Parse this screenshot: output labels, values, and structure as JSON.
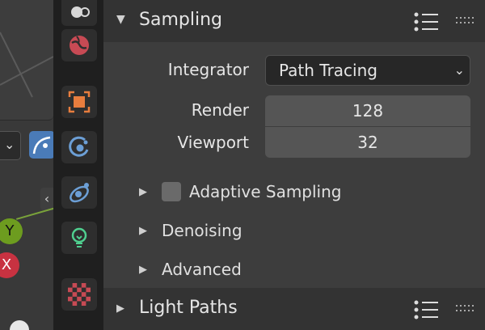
{
  "colors": {
    "panel_bg": "#3d3d3d",
    "header_bg": "#333333",
    "tab_column_bg": "#1f1f1f",
    "field_bg": "#555555",
    "dropdown_bg": "#272727",
    "accent_blue": "#4a7bb8",
    "render_tab_orange": "#e87d3e",
    "axis_y_green": "#6d9c1f",
    "axis_x_red": "#c83241"
  },
  "viewport": {
    "axis_y_label": "Y",
    "axis_x_label": "X",
    "collapse_glyph": "‹"
  },
  "tabs": [
    {
      "name": "tool-tab",
      "icon": "tool-icon"
    },
    {
      "name": "world-tab",
      "icon": "world-icon"
    },
    {
      "name": "object-tab",
      "icon": "object-icon"
    },
    {
      "name": "modifier-tab",
      "icon": "modifier-icon"
    },
    {
      "name": "physics-tab",
      "icon": "physics-icon"
    },
    {
      "name": "light-data-tab",
      "icon": "lightbulb-icon"
    },
    {
      "name": "texture-tab",
      "icon": "checker-texture-icon"
    }
  ],
  "sampling": {
    "title": "Sampling",
    "integrator_label": "Integrator",
    "integrator_value": "Path Tracing",
    "render_label": "Render",
    "render_value": "128",
    "viewport_label": "Viewport",
    "viewport_value": "32",
    "subpanels": {
      "adaptive": "Adaptive Sampling",
      "denoising": "Denoising",
      "advanced": "Advanced"
    }
  },
  "light_paths": {
    "title": "Light Paths"
  }
}
